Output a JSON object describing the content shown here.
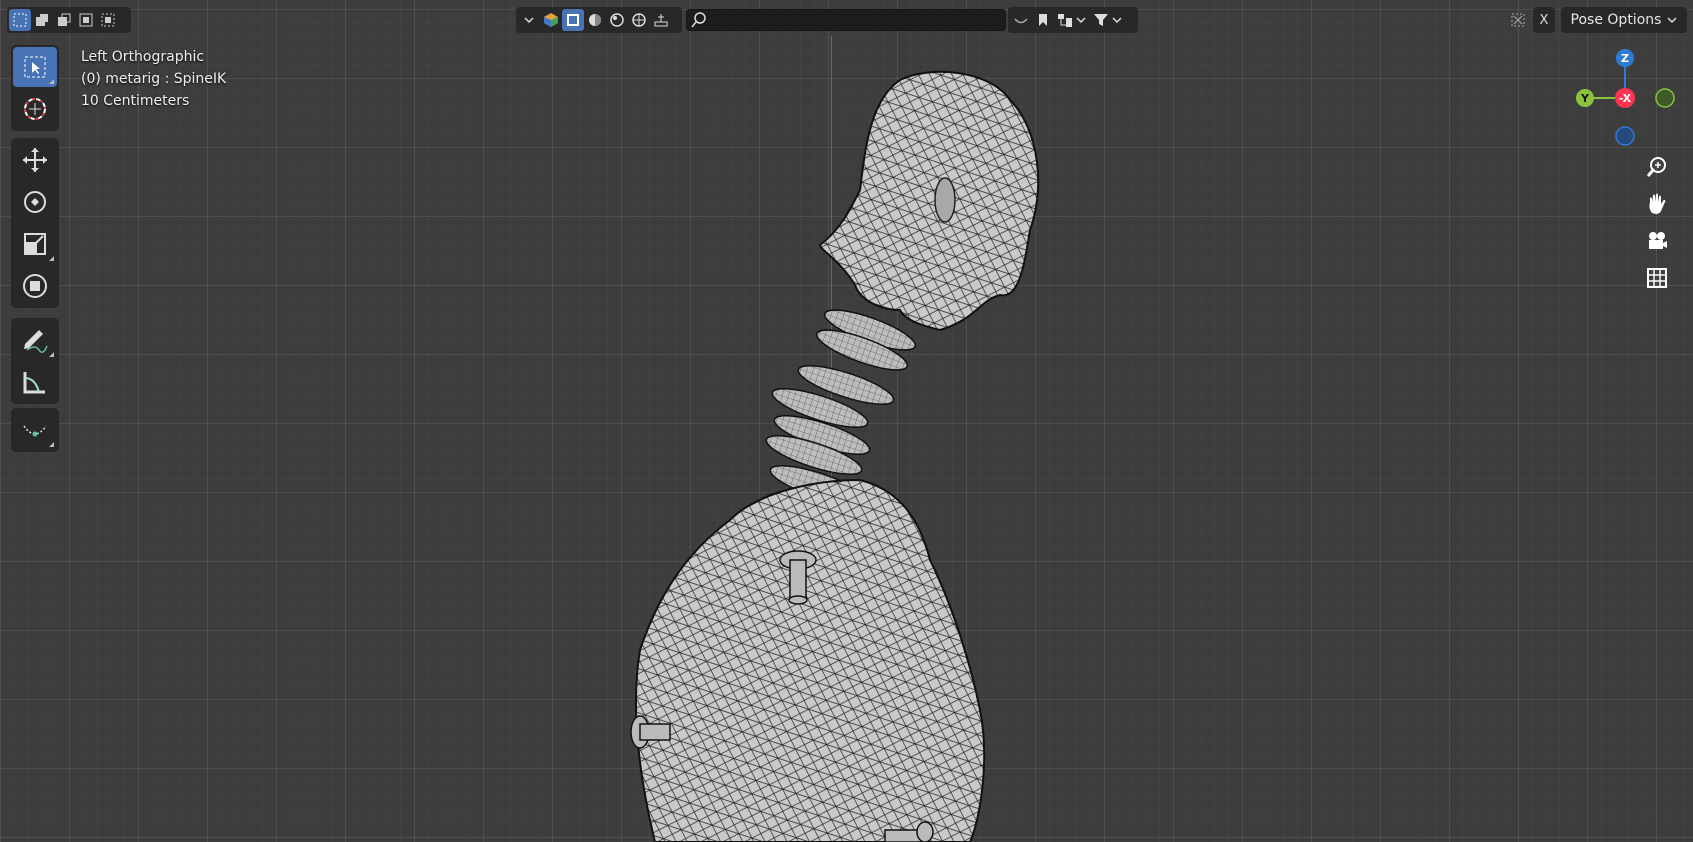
{
  "header": {
    "select_modes": [
      "select-box-icon",
      "select-extend-icon",
      "select-subtract-icon",
      "select-invert-icon",
      "select-intersect-icon"
    ],
    "search": {
      "value": "",
      "placeholder": ""
    },
    "pose_options_label": "Pose Options",
    "xray_toggle_label": "X"
  },
  "viewport": {
    "view_name": "Left Orthographic",
    "object_info": "(0) metarig : SpineIK",
    "scale_label": "10 Centimeters"
  },
  "toolbar": {
    "tools": [
      "select-tool",
      "cursor-tool",
      "move-tool",
      "rotate-tool",
      "scale-tool",
      "transform-tool",
      "annotate-tool",
      "measure-tool",
      "relax-tool"
    ],
    "active_tool": "select-tool"
  },
  "gizmo": {
    "z_label": "Z",
    "y_label": "Y",
    "neg_x_label": "-X",
    "colors": {
      "z": "#2f7ad6",
      "y": "#8bc33f",
      "x": "#ff3352"
    }
  },
  "colors": {
    "accent": "#4772b3",
    "panel": "#282828",
    "viewport": "#3d3d3d"
  }
}
